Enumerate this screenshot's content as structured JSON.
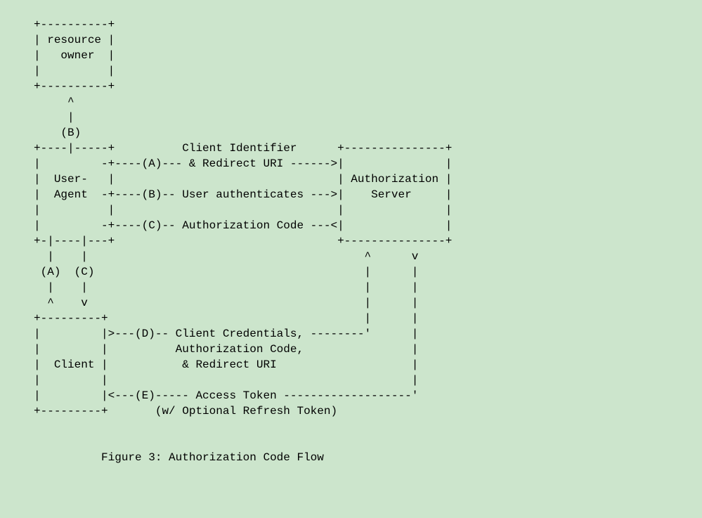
{
  "figure": {
    "entities": {
      "resource_owner": "resource\n  owner",
      "user_agent": "User-\nAgent",
      "client": "Client",
      "auth_server": "Authorization\n   Server"
    },
    "flows": {
      "A": {
        "label": "(A)",
        "text": "Client Identifier\n& Redirect URI"
      },
      "B": {
        "label": "(B)",
        "text": "User authenticates"
      },
      "C": {
        "label": "(C)",
        "text": "Authorization Code"
      },
      "D": {
        "label": "(D)",
        "text": "Client Credentials,\nAuthorization Code,\n& Redirect URI"
      },
      "E": {
        "label": "(E)",
        "text": "Access Token\n(w/ Optional Refresh Token)"
      }
    },
    "caption": "Figure 3: Authorization Code Flow",
    "ascii": "     +----------+\n     | resource |\n     |   owner  |\n     |          |\n     +----------+\n          ^\n          |\n         (B)\n     +----|-----+          Client Identifier      +---------------+\n     |         -+----(A)--- & Redirect URI ------>|               |\n     |  User-   |                                 | Authorization |\n     |  Agent  -+----(B)-- User authenticates --->|    Server     |\n     |          |                                 |               |\n     |         -+----(C)-- Authorization Code ---<|               |\n     +-|----|---+                                 +---------------+\n       |    |                                         ^      v\n      (A)  (C)                                        |      |\n       |    |                                         |      |\n       ^    v                                         |      |\n     +---------+                                      |      |\n     |         |>---(D)-- Client Credentials, --------'      |\n     |         |          Authorization Code,                |\n     |  Client |           & Redirect URI                    |\n     |         |                                             |\n     |         |<---(E)----- Access Token -------------------'\n     +---------+       (w/ Optional Refresh Token)\n\n\n               Figure 3: Authorization Code Flow"
  }
}
